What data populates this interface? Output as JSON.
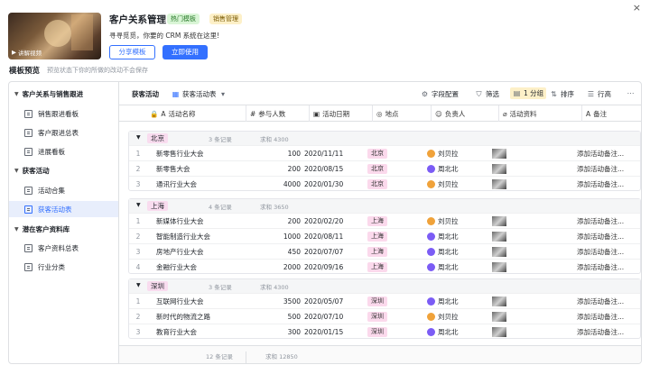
{
  "header": {
    "title": "客户关系管理",
    "tags": [
      "热门模板",
      "销售管理"
    ],
    "description": "寻寻觅觅，你要的 CRM 系统在这里!",
    "share_label": "分享模板",
    "use_label": "立即使用",
    "video_label": "讲解视频",
    "close": "×"
  },
  "preview": {
    "title": "模板预览",
    "desc": "预览状态下你的所做的改动不会保存"
  },
  "sidebar": {
    "groups": [
      {
        "label": "客户关系与销售跟进",
        "items": [
          "销售跟进看板",
          "客户跟进总表",
          "进展看板"
        ]
      },
      {
        "label": "获客活动",
        "items": [
          "活动合集",
          "获客活动表"
        ]
      },
      {
        "label": "潜在客户资料库",
        "items": [
          "客户资料总表",
          "行业分类"
        ]
      }
    ]
  },
  "toolbar": {
    "tab": "获客活动",
    "table": "获客活动表",
    "field": "字段配置",
    "filter": "筛选",
    "group": "1 分组",
    "sort": "排序",
    "rowh": "行高"
  },
  "columns": [
    "活动名称",
    "参与人数",
    "活动日期",
    "地点",
    "负责人",
    "活动资料",
    "备注"
  ],
  "groups": [
    {
      "city": "北京",
      "count": "3 条记录",
      "sum": "求和 4300",
      "rows": [
        {
          "i": "1",
          "name": "新零售行业大会",
          "num": "100",
          "date": "2020/11/11",
          "loc": "北京",
          "person": "刘贝拉",
          "note": "添加活动备注..."
        },
        {
          "i": "2",
          "name": "新零售大会",
          "num": "200",
          "date": "2020/08/15",
          "loc": "北京",
          "person": "周北北",
          "note": "添加活动备注..."
        },
        {
          "i": "3",
          "name": "通讯行业大会",
          "num": "4000",
          "date": "2020/01/30",
          "loc": "北京",
          "person": "刘贝拉",
          "note": "添加活动备注..."
        }
      ]
    },
    {
      "city": "上海",
      "count": "4 条记录",
      "sum": "求和 3650",
      "rows": [
        {
          "i": "1",
          "name": "新媒体行业大会",
          "num": "200",
          "date": "2020/02/20",
          "loc": "上海",
          "person": "刘贝拉",
          "note": "添加活动备注..."
        },
        {
          "i": "2",
          "name": "智能制造行业大会",
          "num": "1000",
          "date": "2020/08/11",
          "loc": "上海",
          "person": "周北北",
          "note": "添加活动备注..."
        },
        {
          "i": "3",
          "name": "房地产行业大会",
          "num": "450",
          "date": "2020/07/07",
          "loc": "上海",
          "person": "周北北",
          "note": "添加活动备注..."
        },
        {
          "i": "4",
          "name": "金融行业大会",
          "num": "2000",
          "date": "2020/09/16",
          "loc": "上海",
          "person": "周北北",
          "note": "添加活动备注..."
        }
      ]
    },
    {
      "city": "深圳",
      "count": "3 条记录",
      "sum": "求和 4300",
      "rows": [
        {
          "i": "1",
          "name": "互联网行业大会",
          "num": "3500",
          "date": "2020/05/07",
          "loc": "深圳",
          "person": "周北北",
          "note": "添加活动备注..."
        },
        {
          "i": "2",
          "name": "新时代的物流之路",
          "num": "500",
          "date": "2020/07/10",
          "loc": "深圳",
          "person": "刘贝拉",
          "note": "添加活动备注..."
        },
        {
          "i": "3",
          "name": "教育行业大会",
          "num": "300",
          "date": "2020/01/15",
          "loc": "深圳",
          "person": "周北北",
          "note": "添加活动备注..."
        }
      ]
    }
  ],
  "footer": {
    "records": "12 条记录",
    "sum": "求和 12850"
  },
  "colors": {
    "accent": "#3370ff",
    "liu": "#f0a23a",
    "zhou": "#7b5cf5"
  }
}
